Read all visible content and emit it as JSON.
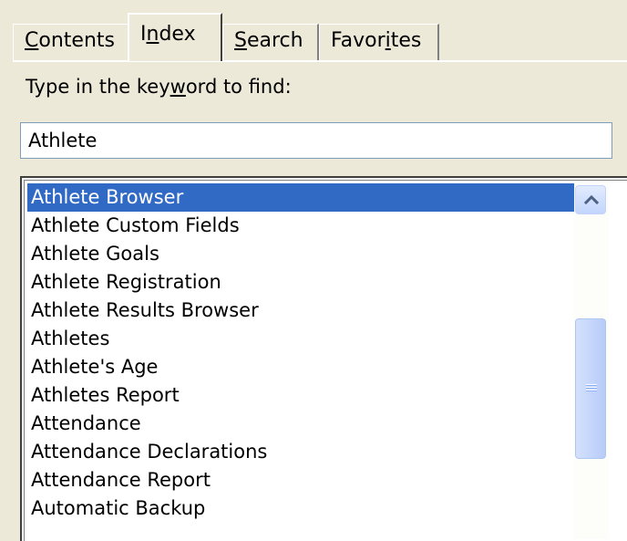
{
  "tabs": [
    {
      "label": "Contents",
      "access_key": "C",
      "active": false
    },
    {
      "label": "Index",
      "access_key": "n",
      "active": true
    },
    {
      "label": "Search",
      "access_key": "S",
      "active": false
    },
    {
      "label": "Favorites",
      "access_key": "i",
      "active": false
    }
  ],
  "prompt": {
    "label": "Type in the keyword to find:",
    "access_key": "w"
  },
  "keyword_input": {
    "value": "Athlete"
  },
  "results": {
    "items": [
      "Athlete Browser",
      "Athlete Custom Fields",
      "Athlete Goals",
      "Athlete Registration",
      "Athlete Results Browser",
      "Athletes",
      "Athlete's Age",
      "Athletes Report",
      "Attendance",
      "Attendance Declarations",
      "Attendance Report",
      "Automatic Backup"
    ],
    "selected_index": 0
  },
  "colors": {
    "window_bg": "#ece9d8",
    "selection_bg": "#316ac5",
    "selection_text": "#ffffff",
    "input_border": "#7f9db9"
  },
  "icons": {
    "scroll_up": "chevron-up-icon",
    "thumb_grip": "grip-icon"
  }
}
